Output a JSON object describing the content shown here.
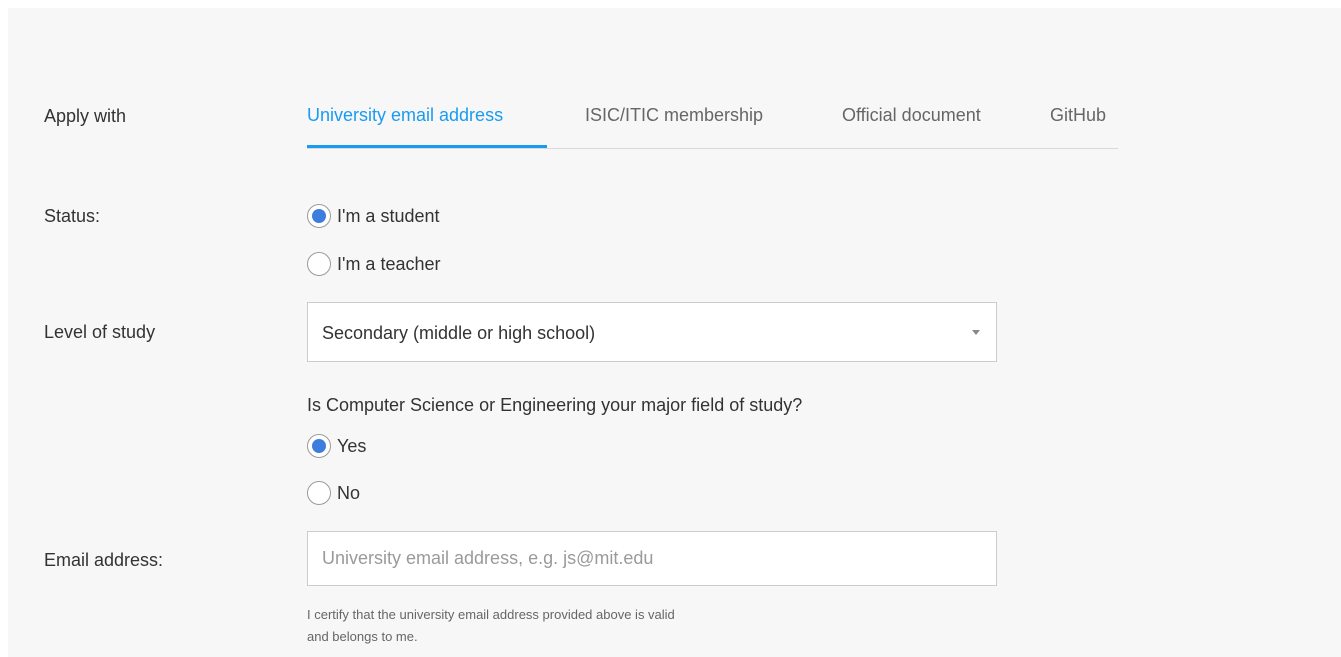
{
  "apply_with": {
    "label": "Apply with",
    "tabs": [
      {
        "label": "University email address",
        "active": true
      },
      {
        "label": "ISIC/ITIC membership",
        "active": false
      },
      {
        "label": "Official document",
        "active": false
      },
      {
        "label": "GitHub",
        "active": false
      }
    ]
  },
  "status": {
    "label": "Status:",
    "options": [
      {
        "label": "I'm a student",
        "checked": true
      },
      {
        "label": "I'm a teacher",
        "checked": false
      }
    ]
  },
  "level_of_study": {
    "label": "Level of study",
    "selected": "Secondary (middle or high school)"
  },
  "cs_major": {
    "question": "Is Computer Science or Engineering your major field of study?",
    "options": [
      {
        "label": "Yes",
        "checked": true
      },
      {
        "label": "No",
        "checked": false
      }
    ]
  },
  "email": {
    "label": "Email address:",
    "value": "",
    "placeholder": "University email address, e.g. js@mit.edu",
    "certify_line1": "I certify that the university email address provided above is valid",
    "certify_line2": "and belongs to me."
  },
  "colors": {
    "accent": "#1a9bf0",
    "radio_checked": "#3d7ddd",
    "panel_background": "#f7f7f7"
  }
}
